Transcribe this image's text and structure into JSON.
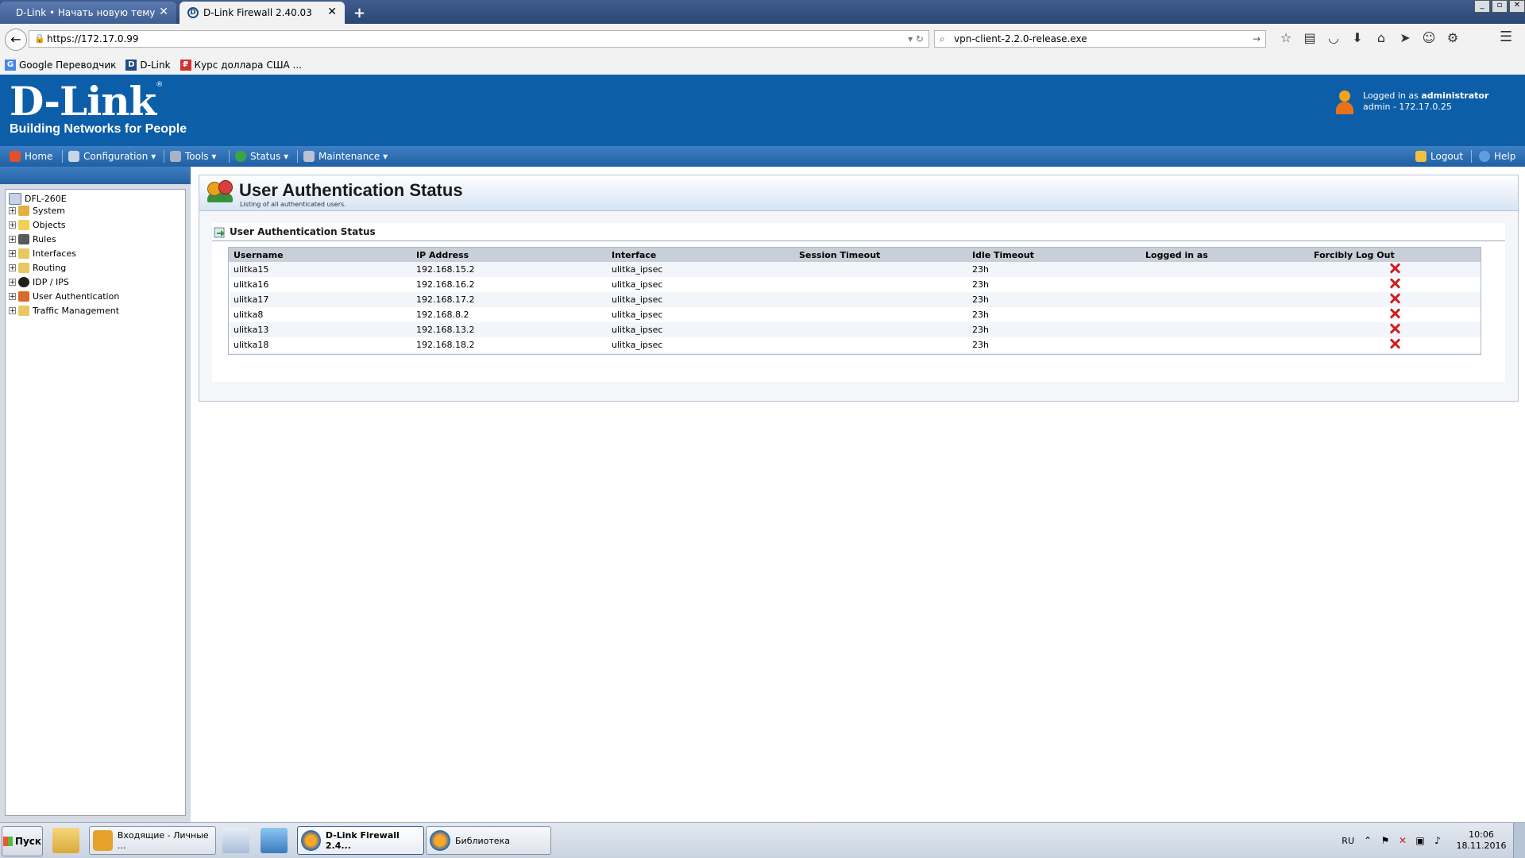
{
  "browser": {
    "tabs": [
      {
        "label": "D-Link • Начать новую тему",
        "close": "✕"
      },
      {
        "label": "D-Link Firewall 2.40.03",
        "close": "✕"
      }
    ],
    "new_tab": "+",
    "url": "https://172.17.0.99",
    "search_value": "vpn-client-2.2.0-release.exe",
    "bookmarks": [
      {
        "label": "Google Переводчик"
      },
      {
        "label": "D-Link"
      },
      {
        "label": "Курс доллара США ..."
      }
    ]
  },
  "header": {
    "logo_brand": "D-Link",
    "logo_tagline": "Building Networks for People",
    "login_prefix": "Logged in as ",
    "login_user": "administrator",
    "login_detail": "admin - 172.17.0.25"
  },
  "menu": {
    "home": "Home",
    "configuration": "Configuration",
    "tools": "Tools",
    "status": "Status",
    "maintenance": "Maintenance",
    "logout": "Logout",
    "help": "Help",
    "caret": "▾"
  },
  "tree": {
    "root": "DFL-260E",
    "items": [
      "System",
      "Objects",
      "Rules",
      "Interfaces",
      "Routing",
      "IDP / IPS",
      "User Authentication",
      "Traffic Management"
    ]
  },
  "page": {
    "title": "User Authentication Status",
    "subtitle": "Listing of all authenticated users.",
    "section_title": "User Authentication Status"
  },
  "table": {
    "columns": [
      "Username",
      "IP Address",
      "Interface",
      "Session Timeout",
      "Idle Timeout",
      "Logged in as",
      "Forcibly Log Out"
    ],
    "rows": [
      {
        "username": "ulitka15",
        "ip": "192.168.15.2",
        "interface": "ulitka_ipsec",
        "session": "",
        "idle": "23h",
        "logged_as": ""
      },
      {
        "username": "ulitka16",
        "ip": "192.168.16.2",
        "interface": "ulitka_ipsec",
        "session": "",
        "idle": "23h",
        "logged_as": ""
      },
      {
        "username": "ulitka17",
        "ip": "192.168.17.2",
        "interface": "ulitka_ipsec",
        "session": "",
        "idle": "23h",
        "logged_as": ""
      },
      {
        "username": "ulitka8",
        "ip": "192.168.8.2",
        "interface": "ulitka_ipsec",
        "session": "",
        "idle": "23h",
        "logged_as": ""
      },
      {
        "username": "ulitka13",
        "ip": "192.168.13.2",
        "interface": "ulitka_ipsec",
        "session": "",
        "idle": "23h",
        "logged_as": ""
      },
      {
        "username": "ulitka18",
        "ip": "192.168.18.2",
        "interface": "ulitka_ipsec",
        "session": "",
        "idle": "23h",
        "logged_as": ""
      }
    ]
  },
  "taskbar": {
    "start": "Пуск",
    "tasks": [
      {
        "label": "Входящие - Личные ..."
      },
      {
        "label": "D-Link Firewall 2.4..."
      },
      {
        "label": "Библиотека"
      }
    ],
    "lang": "RU",
    "time": "10:06",
    "date": "18.11.2016"
  },
  "colors": {
    "brand_blue": "#0d5ea8",
    "menu_blue": "#2a6bb0",
    "logout_red": "#d11d1d"
  }
}
